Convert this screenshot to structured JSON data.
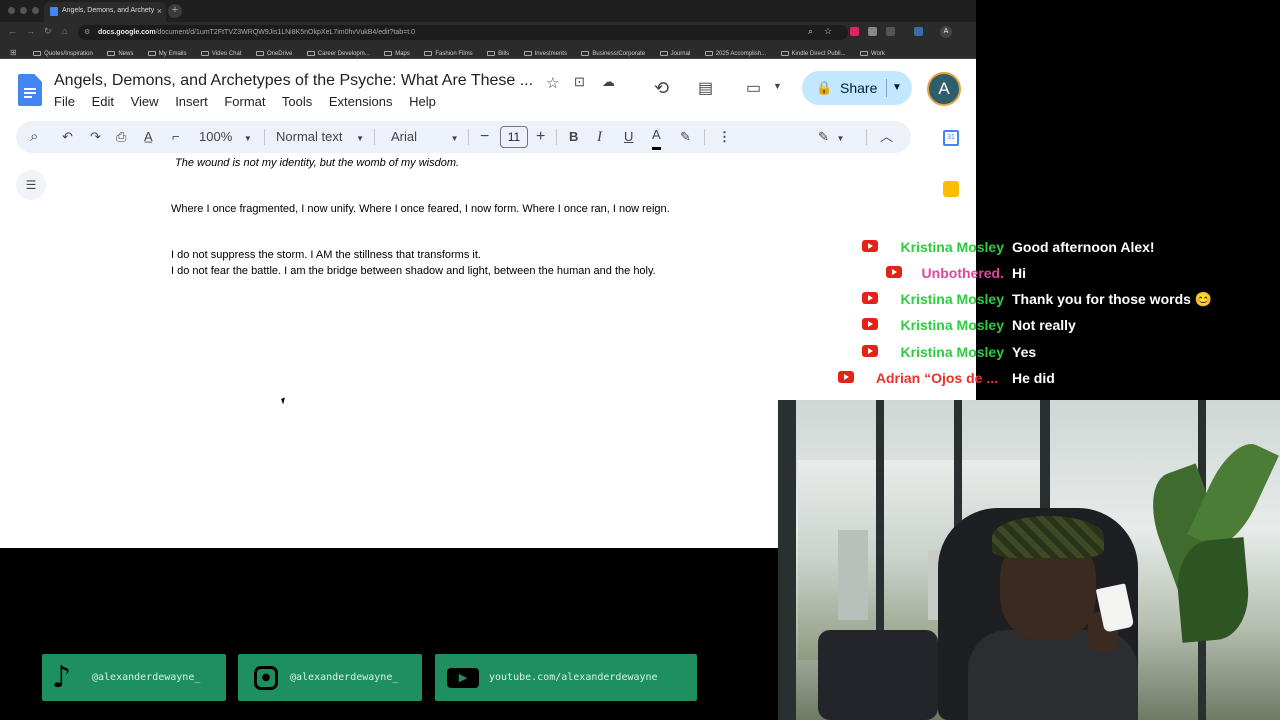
{
  "browser": {
    "tab_title": "Angels, Demons, and Archety",
    "new_tab_symbol": "+",
    "close_symbol": "×",
    "url_domain": "docs.google.com",
    "url_path": "/document/d/1umT2FtTVZ3WRQW9Jis1LNi8K5nOkpXeL7im0hvVukB4/edit?tab=t.0",
    "profile_initial": "A",
    "bookmarks": [
      "Quotes/Inspiration",
      "News",
      "My Emails",
      "Video Chat",
      "OneDrive",
      "Career Developm...",
      "Maps",
      "Fashion Films",
      "Bills",
      "Investments",
      "Business/Corporate",
      "Journal",
      "2025 Accomplish...",
      "Kindle Direct Publi...",
      "Work"
    ]
  },
  "docs": {
    "title": "Angels, Demons, and Archetypes of the Psyche: What Are These ...",
    "menu": [
      "File",
      "Edit",
      "View",
      "Insert",
      "Format",
      "Tools",
      "Extensions",
      "Help"
    ],
    "share_label": "Share",
    "avatar_initial": "A",
    "toolbar": {
      "zoom": "100%",
      "style": "Normal text",
      "font": "Arial",
      "font_size": "11"
    },
    "calendar_day": "31",
    "paragraphs": [
      {
        "text": "The wound is not my identity, but the womb of my wisdom.",
        "italic": true
      },
      {
        "text": "Where I once fragmented, I now unify. Where I once feared, I now form. Where I once ran, I now reign.",
        "italic": false
      },
      {
        "text": "I do not suppress the storm. I AM the stillness that transforms it.",
        "italic": false
      },
      {
        "text": "I do not fear the battle. I am the bridge between shadow and light, between the human and the holy.",
        "italic": false
      }
    ]
  },
  "chat": {
    "messages": [
      {
        "author": "Kristina Mosley",
        "text": "Good afternoon Alex!",
        "color": "#2ecc40"
      },
      {
        "author": "Unbothered.",
        "text": "Hi",
        "color": "#e0479e"
      },
      {
        "author": "Kristina Mosley",
        "text": "Thank you for those words 😊",
        "color": "#2ecc40"
      },
      {
        "author": "Kristina Mosley",
        "text": "Not really",
        "color": "#2ecc40"
      },
      {
        "author": "Kristina Mosley",
        "text": "Yes",
        "color": "#2ecc40"
      },
      {
        "author": "Adrian “Ojos de ...",
        "text": "He did",
        "color": "#e8322a"
      }
    ]
  },
  "socials": [
    {
      "icon": "tiktok-icon",
      "handle": "@alexanderdewayne_"
    },
    {
      "icon": "instagram-icon",
      "handle": "@alexanderdewayne_"
    },
    {
      "icon": "youtube-icon",
      "handle": "youtube.com/alexanderdewayne"
    }
  ],
  "colors": {
    "share_bg": "#c2e7ff",
    "toolbar_bg": "#edf2fa",
    "social_bg": "#1e8f5e",
    "youtube_red": "#e62117"
  }
}
